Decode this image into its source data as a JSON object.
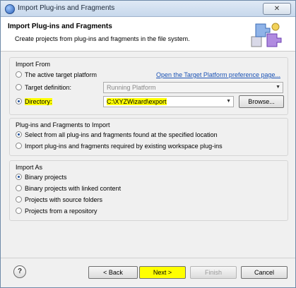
{
  "window": {
    "title": "Import Plug-ins and Fragments",
    "close_glyph": "✕"
  },
  "header": {
    "title": "Import Plug-ins and Fragments",
    "description": "Create projects from plug-ins and fragments in the file system."
  },
  "import_from": {
    "label": "Import From",
    "option_active": "The active target platform",
    "link": "Open the Target Platform preference page...",
    "option_target": "Target definition:",
    "target_value": "Running Platform",
    "option_directory": "Directory:",
    "directory_value": "C:\\XYZWizard\\export",
    "browse_label": "Browse..."
  },
  "plugins_to_import": {
    "label": "Plug-ins and Fragments to Import",
    "option_all": "Select from all plug-ins and fragments found at the specified location",
    "option_required": "Import plug-ins and fragments required by existing workspace plug-ins"
  },
  "import_as": {
    "label": "Import As",
    "options": [
      "Binary projects",
      "Binary projects with linked content",
      "Projects with source folders",
      "Projects from a repository"
    ]
  },
  "footer": {
    "help_glyph": "?",
    "back_label": "< Back",
    "next_label": "Next >",
    "finish_label": "Finish",
    "cancel_label": "Cancel"
  },
  "colors": {
    "highlight": "#ffff00",
    "link": "#1a52b5"
  }
}
